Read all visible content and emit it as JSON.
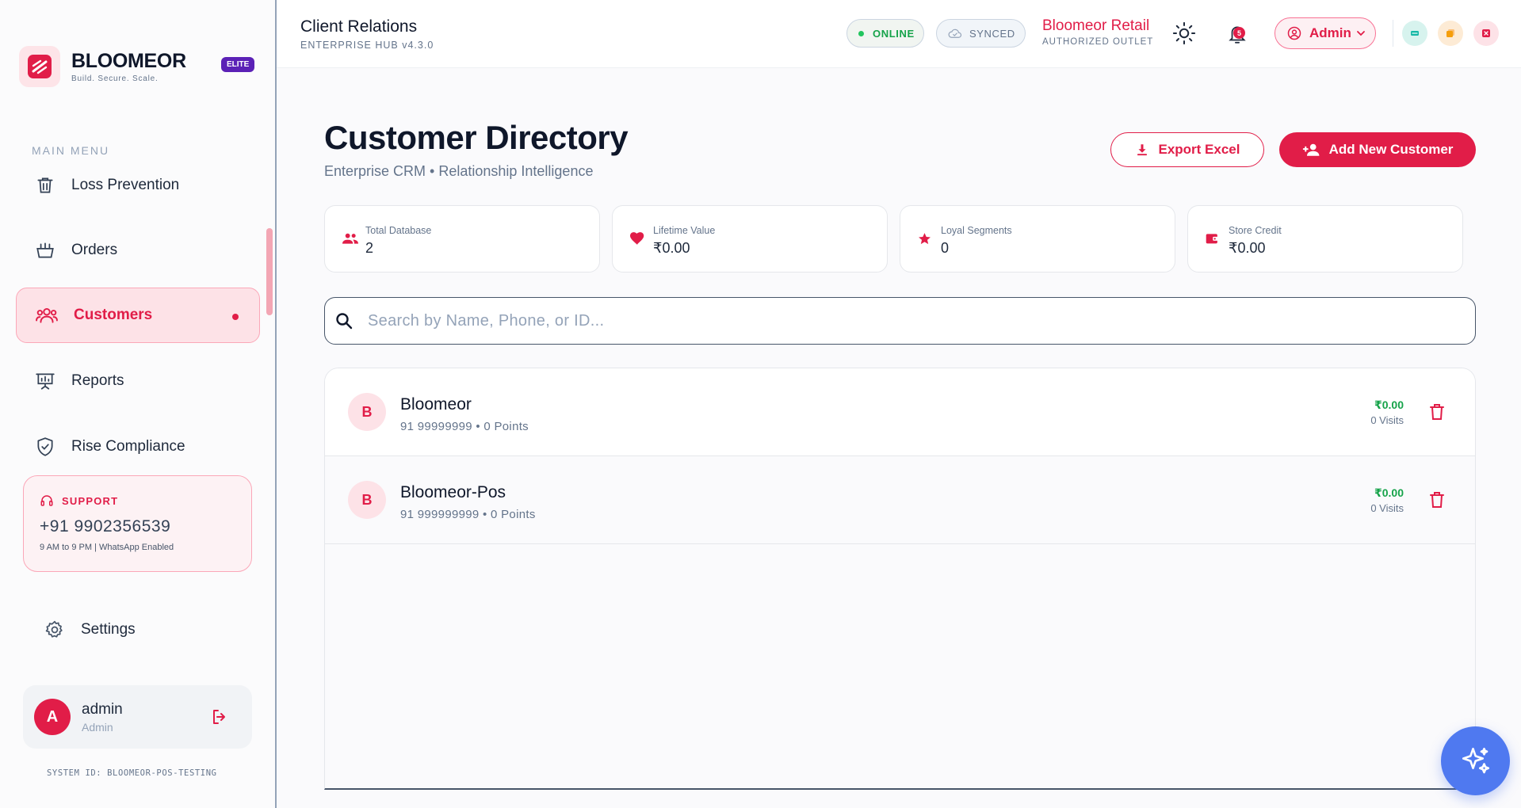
{
  "brand": {
    "name": "BLOOMEOR",
    "tagline": "Build. Secure. Scale.",
    "badge": "ELITE"
  },
  "sidebar": {
    "menu_title": "MAIN MENU",
    "items": [
      {
        "label": "Loss Prevention",
        "icon": "trash-icon",
        "active": false
      },
      {
        "label": "Orders",
        "icon": "basket-icon",
        "active": false
      },
      {
        "label": "Customers",
        "icon": "users-icon",
        "active": true
      },
      {
        "label": "Reports",
        "icon": "presentation-icon",
        "active": false
      },
      {
        "label": "Rise Compliance",
        "icon": "shield-check-icon",
        "active": false
      }
    ],
    "support": {
      "label": "SUPPORT",
      "phone": "+91 9902356539",
      "hours": "9 AM to 9 PM | WhatsApp Enabled"
    },
    "settings_label": "Settings",
    "user": {
      "initial": "A",
      "name": "admin",
      "role": "Admin"
    },
    "system_id": "SYSTEM ID: BLOOMEOR-POS-TESTING"
  },
  "topbar": {
    "title": "Client Relations",
    "subtitle": "ENTERPRISE HUB v4.3.0",
    "online_label": "ONLINE",
    "synced_label": "SYNCED",
    "store_name": "Bloomeor Retail",
    "store_sub": "AUTHORIZED OUTLET",
    "notification_count": "5",
    "admin_label": "Admin"
  },
  "page": {
    "title": "Customer Directory",
    "subtitle": "Enterprise CRM • Relationship Intelligence",
    "export_label": "Export Excel",
    "add_label": "Add New Customer"
  },
  "stats": [
    {
      "label": "Total Database",
      "value": "2",
      "icon": "users-icon"
    },
    {
      "label": "Lifetime Value",
      "value": "₹0.00",
      "icon": "heart-icon"
    },
    {
      "label": "Loyal Segments",
      "value": "0",
      "icon": "star-icon"
    },
    {
      "label": "Store Credit",
      "value": "₹0.00",
      "icon": "wallet-icon"
    }
  ],
  "search": {
    "placeholder": "Search by Name, Phone, or ID..."
  },
  "customers": [
    {
      "initial": "B",
      "name": "Bloomeor",
      "meta": "91 99999999 • 0 Points",
      "amount": "₹0.00",
      "visits": "0 Visits"
    },
    {
      "initial": "B",
      "name": "Bloomeor-Pos",
      "meta": "91 999999999 • 0 Points",
      "amount": "₹0.00",
      "visits": "0 Visits"
    }
  ],
  "colors": {
    "accent": "#e11d48",
    "success": "#16a34a",
    "fab": "#4f79f0",
    "elite": "#5b21b6"
  }
}
